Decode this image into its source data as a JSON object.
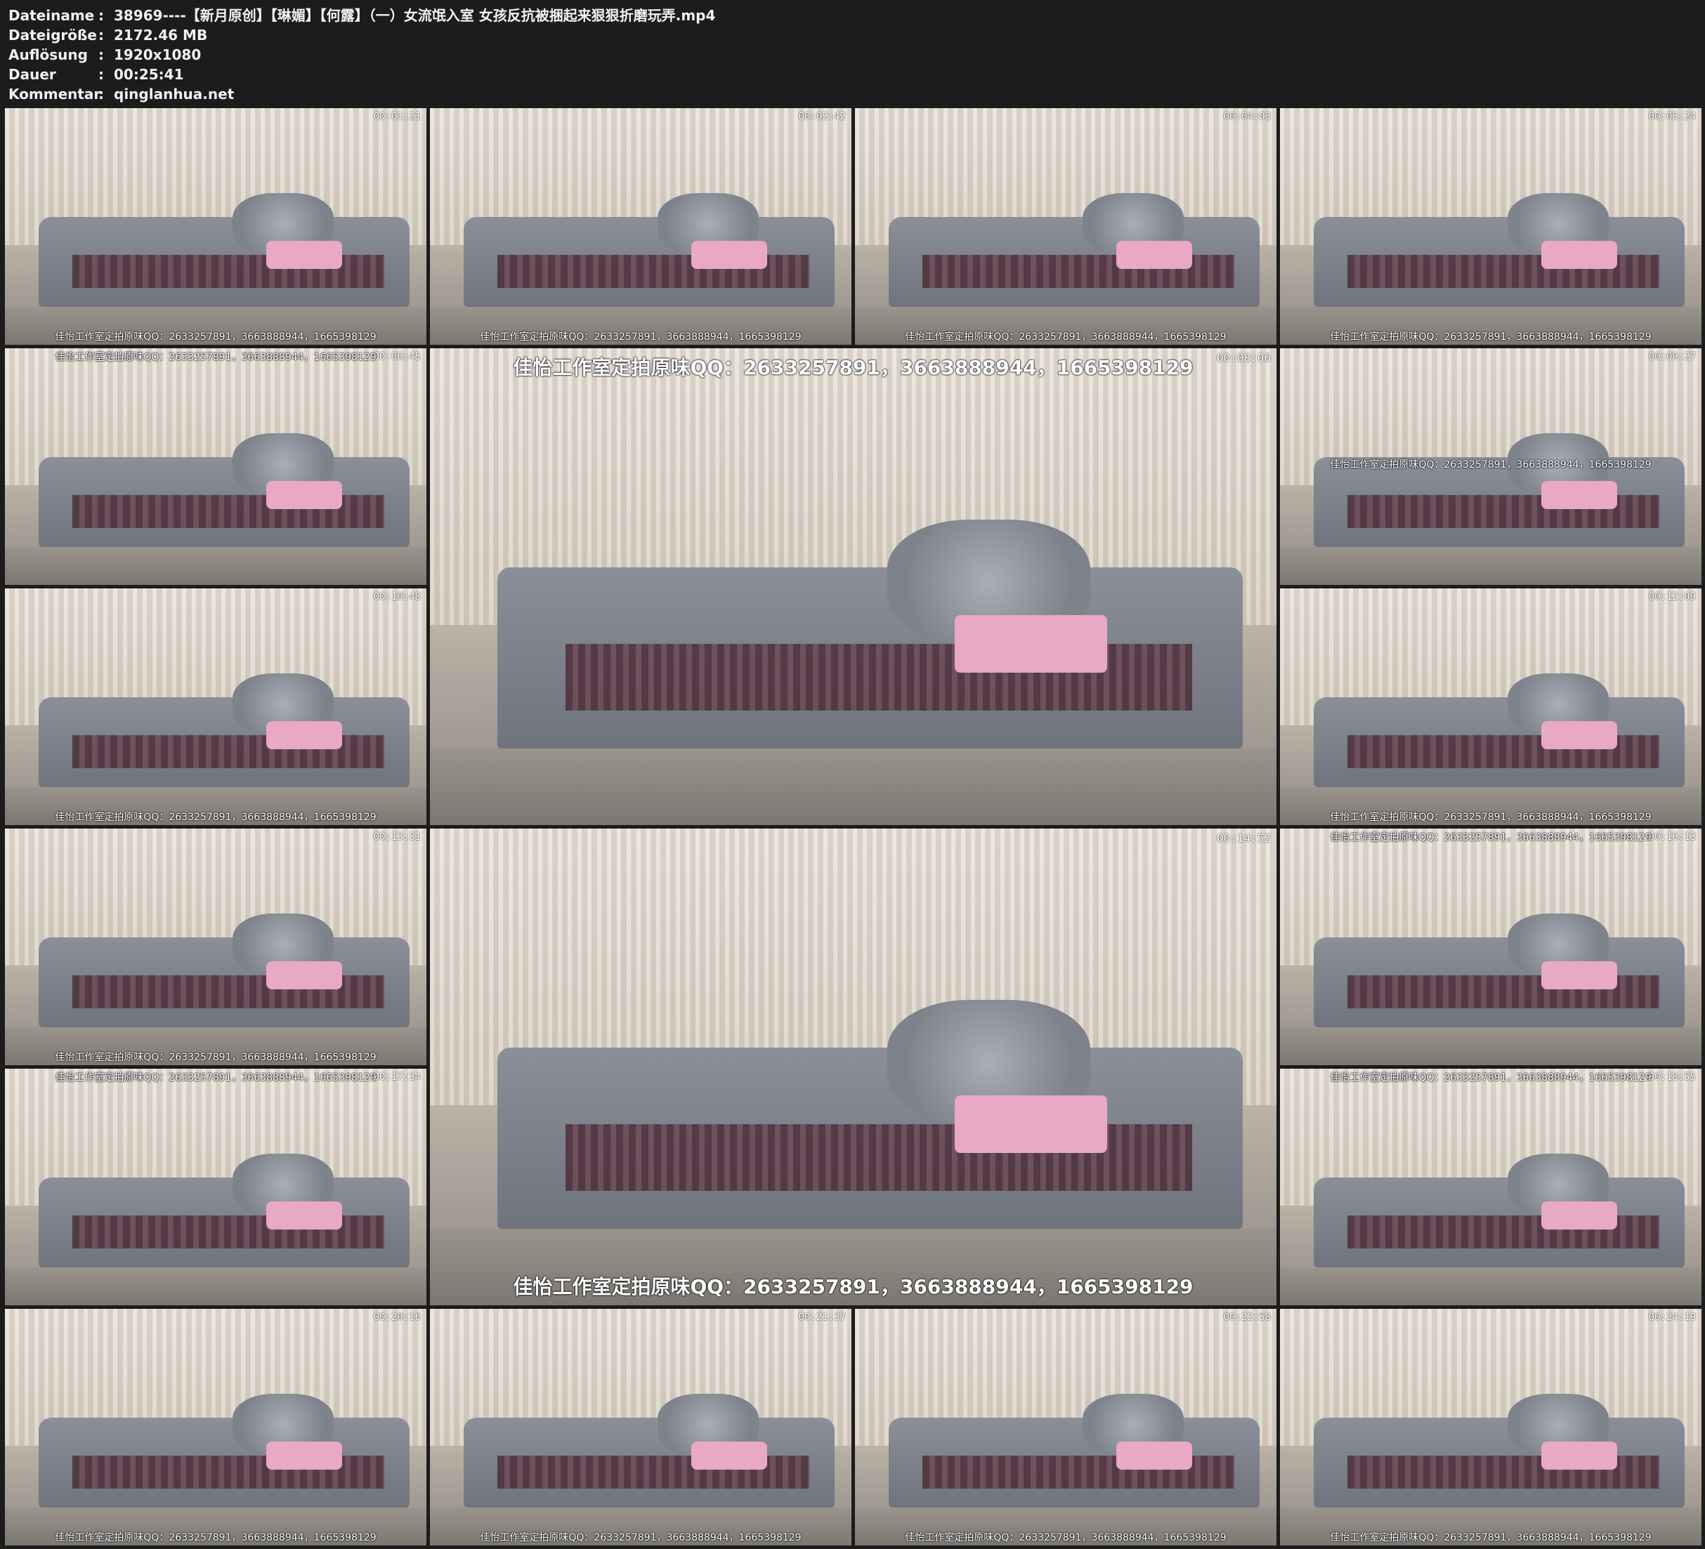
{
  "meta": {
    "rows": [
      {
        "key": "Dateiname",
        "value": "38969----【新月原创】【琳媚】【何露】（一）女流氓入室 女孩反抗被捆起来狠狠折磨玩弄.mp4"
      },
      {
        "key": "Dateigröße",
        "value": "2172.46 MB"
      },
      {
        "key": "Auflösung",
        "value": "1920x1080"
      },
      {
        "key": "Dauer",
        "value": "00:25:41"
      },
      {
        "key": "Kommentar",
        "value": "qinglanhua.net"
      }
    ]
  },
  "watermark": "佳怡工作室定拍原味QQ：2633257891，3663888944，1665398129",
  "thumbnails": [
    {
      "time": "00:01:21",
      "wm": "bottom"
    },
    {
      "time": "00:02:42",
      "wm": "bottom"
    },
    {
      "time": "00:04:03",
      "wm": "bottom"
    },
    {
      "time": "00:05:24",
      "wm": "bottom"
    },
    {
      "time": "00:06:45",
      "wm": "top"
    },
    {
      "time": "00:08:06",
      "wm": "top"
    },
    {
      "time": "00:09:27",
      "wm": "middle"
    },
    {
      "time": "00:10:48",
      "wm": "bottom"
    },
    {
      "time": "00:12:09",
      "wm": "bottom"
    },
    {
      "time": "00:13:31",
      "wm": "bottom"
    },
    {
      "time": "00:14:52",
      "wm": "bottom"
    },
    {
      "time": "00:16:13",
      "wm": "top"
    },
    {
      "time": "00:17:34",
      "wm": "top"
    },
    {
      "time": "00:18:55",
      "wm": "top"
    },
    {
      "time": "00:20:16",
      "wm": "bottom"
    },
    {
      "time": "00:21:37",
      "wm": "bottom"
    },
    {
      "time": "00:22:58",
      "wm": "bottom"
    },
    {
      "time": "00:24:19",
      "wm": "bottom"
    }
  ]
}
